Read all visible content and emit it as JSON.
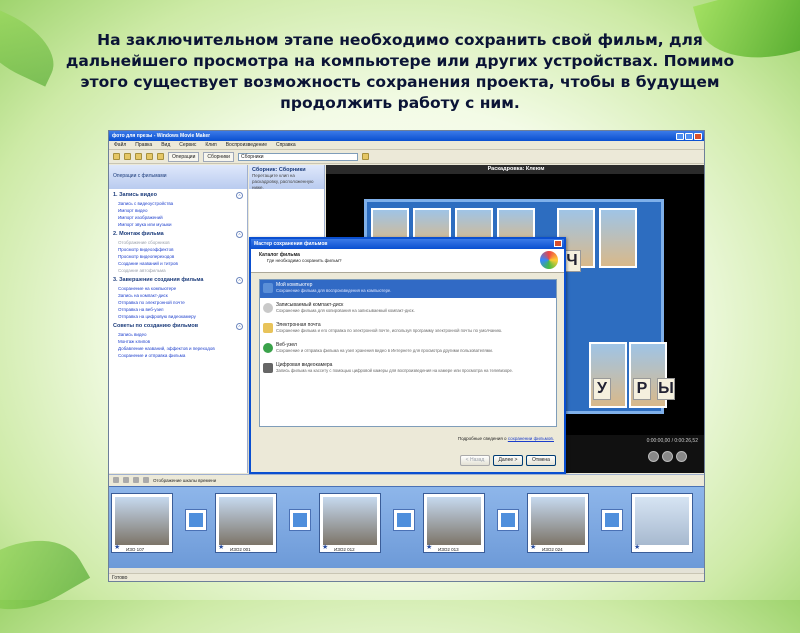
{
  "heading": "На заключительном этапе необходимо сохранить свой фильм, для дальнейшего просмотра на компьютере или других устройствах. Помимо этого существует возможность сохранения проекта, чтобы в будущем продолжить работу с ним.",
  "window": {
    "title": "фото для презы - Windows Movie Maker"
  },
  "menu": [
    "Файл",
    "Правка",
    "Вид",
    "Сервис",
    "Клип",
    "Воспроизведение",
    "Справка"
  ],
  "toolbar": {
    "tasks_button": "Операции",
    "collections_button": "Сборники",
    "collection_select": "Сборники"
  },
  "tasks": {
    "header": "Операции с фильмами",
    "sections": [
      {
        "title": "1. Запись видео",
        "links": [
          "Запись с видеоустройства",
          "Импорт видео",
          "Импорт изображений",
          "Импорт звука или музыки"
        ]
      },
      {
        "title": "2. Монтаж фильма",
        "links": [
          "Отображение сборников",
          "Просмотр видеоэффектов",
          "Просмотр видеопереходов",
          "Создание названий и титров",
          "Создание автофильма"
        ]
      },
      {
        "title": "3. Завершение создания фильма",
        "links": [
          "Сохранение на компьютере",
          "Запись на компакт-диск",
          "Отправка по электронной почте",
          "Отправка на веб-узел",
          "Отправка на цифровую видеокамеру"
        ]
      },
      {
        "title": "Советы по созданию фильмов",
        "links": [
          "Запись видео",
          "Монтаж клипов",
          "Добавление названий, эффектов и переходов",
          "Сохранение и отправка фильма"
        ]
      }
    ]
  },
  "collection": {
    "title": "Сборник: Сборники",
    "hint": "Перетащите клип на раскадровку, расположенную ниже."
  },
  "preview": {
    "header": "Раскадровка: Клеюм",
    "time": "0:00:00,00 / 0:00:26,52"
  },
  "dialog": {
    "title": "Мастер сохранения фильмов",
    "heading": "Каталог фильма",
    "question": "Где необходимо сохранить фильм?",
    "options": [
      {
        "label": "Мой компьютер",
        "desc": "Сохранение фильма для воспроизведения на компьютере."
      },
      {
        "label": "Записываемый компакт-диск",
        "desc": "Сохранение фильма для копирования на записываемый компакт-диск."
      },
      {
        "label": "Электронная почта",
        "desc": "Сохранение фильма и его отправка по электронной почте, используя программу электронной почты по умолчанию."
      },
      {
        "label": "Веб-узел",
        "desc": "Сохранение и отправка фильма на узел хранения видео в Интернете для просмотра другими пользователями."
      },
      {
        "label": "Цифровая видеокамера",
        "desc": "Запись фильма на кассету с помощью цифровой камеры для воспроизведения на камере или просмотра на телевизоре."
      }
    ],
    "more_prefix": "Подробные сведения о",
    "more_link": "сохранении фильмов.",
    "back": "< Назад",
    "next": "Далее >",
    "cancel": "Отмена"
  },
  "timeline_toggle": "Отображение шкалы времени",
  "clips": [
    "ИЗО 107",
    "ИЗО2 001",
    "ИЗО2 012",
    "ИЗО2 013",
    "ИЗО2 024"
  ],
  "status": "Готово",
  "colors": {
    "titlebar": "#0a4fd0",
    "selection": "#316ac5",
    "storyboard": "#8eb6ea"
  }
}
